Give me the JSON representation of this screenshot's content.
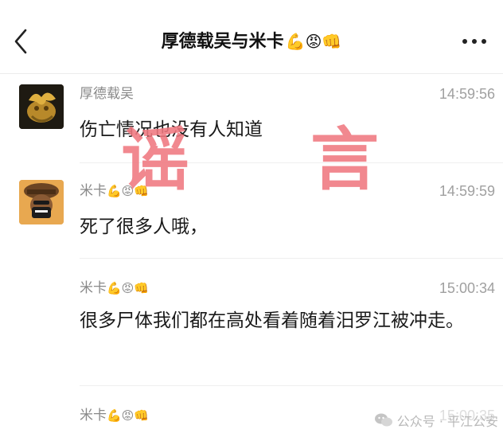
{
  "header": {
    "title": "厚德载吴与米卡",
    "title_emojis": "💪😡👊",
    "back_icon": "chevron-left-icon",
    "more_icon": "more-dots-icon"
  },
  "messages": [
    {
      "sender": "厚德载吴",
      "sender_emojis": "",
      "time": "14:59:56",
      "text": "伤亡情况也没有人知道",
      "avatar": "golden-dragon-avatar"
    },
    {
      "sender": "米卡",
      "sender_emojis": "💪😡👊",
      "time": "14:59:59",
      "text": "死了很多人哦，",
      "avatar": "masked-person-avatar"
    },
    {
      "sender": "米卡",
      "sender_emojis": "💪😡👊",
      "time": "15:00:34",
      "text": "很多尸体我们都在高处看着随着汨罗江被冲走。",
      "avatar": ""
    },
    {
      "sender": "米卡",
      "sender_emojis": "💪😡👊",
      "time": "15:00:35",
      "text": "",
      "avatar": ""
    }
  ],
  "stamp": {
    "char1": "谣",
    "char2": "言",
    "color": "#f07880"
  },
  "watermark": {
    "label": "公众号 · 平江公安"
  }
}
